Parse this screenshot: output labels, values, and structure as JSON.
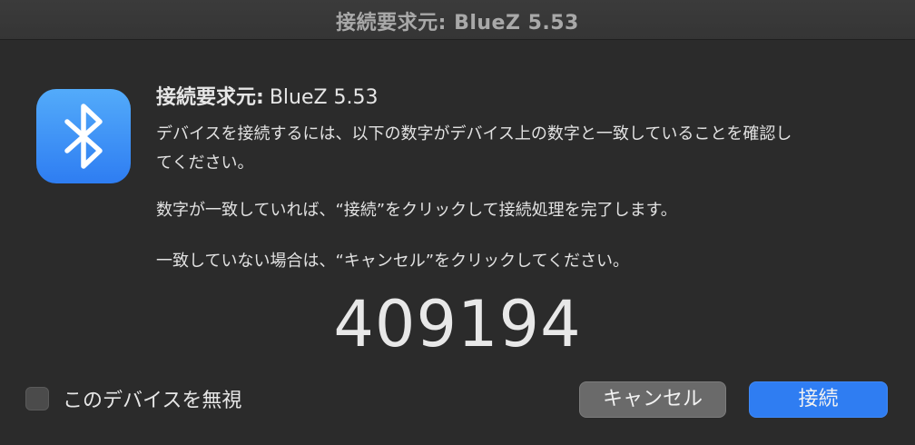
{
  "window": {
    "title": "接続要求元: BlueZ 5.53"
  },
  "dialog": {
    "icon": "bluetooth-icon",
    "heading_label": "接続要求元:",
    "heading_value": "BlueZ 5.53",
    "paragraph1_line1": "デバイスを接続するには、以下の数字がデバイス上の数字と一致していることを確認し",
    "paragraph1_line2": "てください。",
    "paragraph2": "数字が一致していれば、“接続”をクリックして接続処理を完了します。",
    "paragraph3": "一致していない場合は、“キャンセル”をクリックしてください。",
    "passkey": "409194",
    "ignore_checkbox_label": "このデバイスを無視",
    "ignore_checked": false,
    "cancel_label": "キャンセル",
    "connect_label": "接続"
  },
  "colors": {
    "background": "#2b2b2b",
    "accent": "#2f7df2",
    "icon_gradient_top": "#53abfa",
    "icon_gradient_bottom": "#2e7df2"
  }
}
